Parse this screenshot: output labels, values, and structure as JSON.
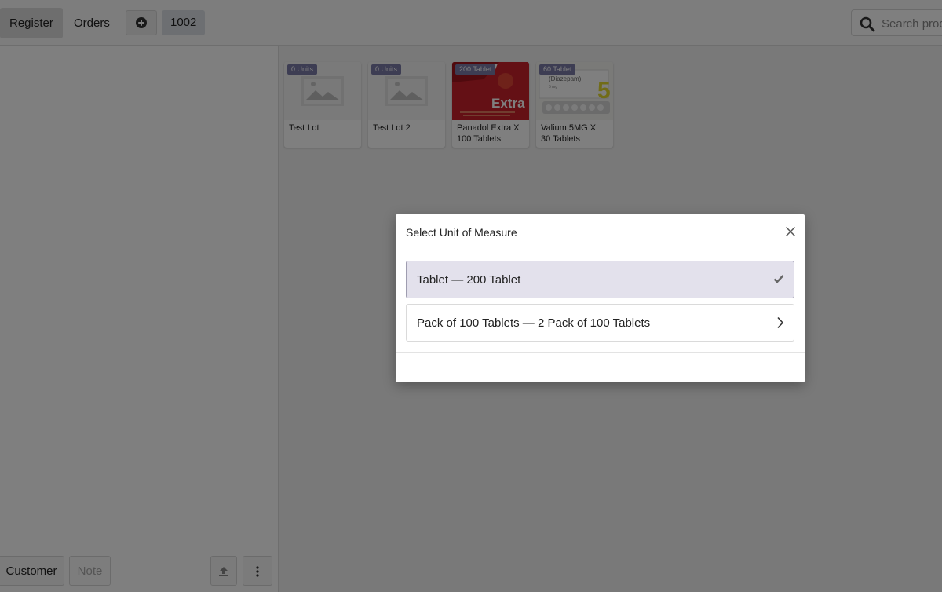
{
  "navbar": {
    "tabs": [
      {
        "label": "Register",
        "active": true
      },
      {
        "label": "Orders",
        "active": false
      }
    ],
    "add_order_icon": "plus-circle-icon",
    "current_order": "1002",
    "search": {
      "placeholder": "Search products...",
      "icon": "search-icon"
    }
  },
  "left_pane": {
    "customer_label": "Customer",
    "note_label": "Note",
    "upload_icon": "upload-icon",
    "more_icon": "more-vertical-icon"
  },
  "products": [
    {
      "name": "Test Lot",
      "badge": "0 Units",
      "image": "placeholder"
    },
    {
      "name": "Test Lot 2",
      "badge": "0 Units",
      "image": "placeholder"
    },
    {
      "name": "Panadol Extra X\n100 Tablets",
      "badge": "200 Tablet",
      "image": "panadol-box",
      "image_text": "Extra"
    },
    {
      "name": "Valium 5MG X\n30 Tablets",
      "badge": "60 Tablet",
      "image": "valium-box",
      "image_text": "(Diazepam)"
    }
  ],
  "modal": {
    "title": "Select Unit of Measure",
    "close_icon": "close-icon",
    "options": [
      {
        "label": "Tablet — 200 Tablet",
        "selected": true,
        "icon": "check-icon"
      },
      {
        "label": "Pack of 100 Tablets — 2 Pack of 100 Tablets",
        "selected": false,
        "icon": "chevron-right-icon"
      }
    ]
  },
  "colors": {
    "badge_bg": "#7b7ba6",
    "selected_option_bg": "#e3e1ec",
    "overlay": "rgba(0,0,0,0.5)",
    "panadol_red": "#c8202a",
    "valium_yellow": "#e3d830"
  }
}
